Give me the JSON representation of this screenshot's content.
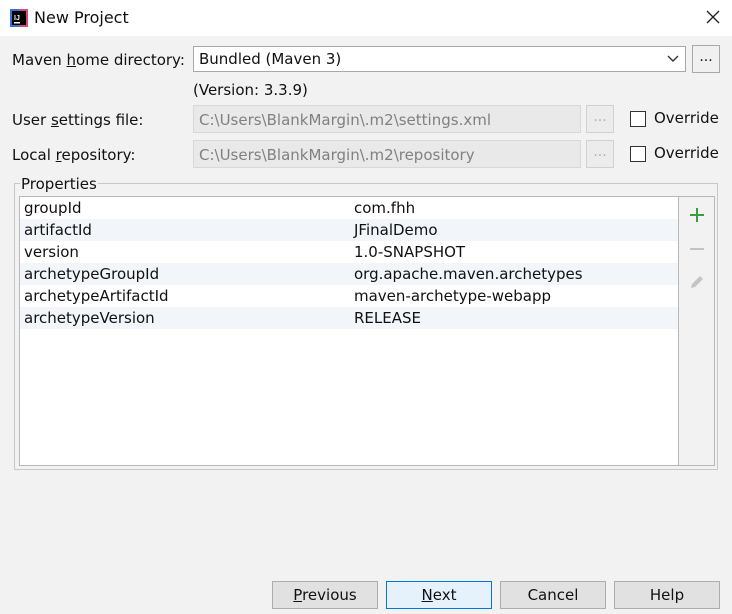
{
  "window": {
    "title": "New Project"
  },
  "form": {
    "maven_home": {
      "label_pre": "Maven ",
      "label_accel": "h",
      "label_post": "ome directory:",
      "value": "Bundled (Maven 3)",
      "browse": "...",
      "version": "(Version: 3.3.9)"
    },
    "user_settings": {
      "label_pre": "User ",
      "label_accel": "s",
      "label_post": "ettings file:",
      "value": "C:\\Users\\BlankMargin\\.m2\\settings.xml",
      "browse": "...",
      "override": "Override",
      "override_checked": false
    },
    "local_repo": {
      "label_pre": "Local ",
      "label_accel": "r",
      "label_post": "epository:",
      "value": "C:\\Users\\BlankMargin\\.m2\\repository",
      "browse": "...",
      "override": "Override",
      "override_checked": false
    }
  },
  "properties": {
    "title": "Properties",
    "rows": [
      {
        "key": "groupId",
        "value": "com.fhh"
      },
      {
        "key": "artifactId",
        "value": "JFinalDemo"
      },
      {
        "key": "version",
        "value": "1.0-SNAPSHOT"
      },
      {
        "key": "archetypeGroupId",
        "value": "org.apache.maven.archetypes"
      },
      {
        "key": "archetypeArtifactId",
        "value": "maven-archetype-webapp"
      },
      {
        "key": "archetypeVersion",
        "value": "RELEASE"
      }
    ],
    "tools": [
      "add-icon",
      "remove-icon",
      "edit-icon"
    ]
  },
  "buttons": {
    "previous_accel": "P",
    "previous_rest": "revious",
    "next_accel": "N",
    "next_rest": "ext",
    "cancel": "Cancel",
    "help": "Help"
  },
  "colors": {
    "add": "#3b9c3b",
    "default_button_border": "#0078d7"
  }
}
